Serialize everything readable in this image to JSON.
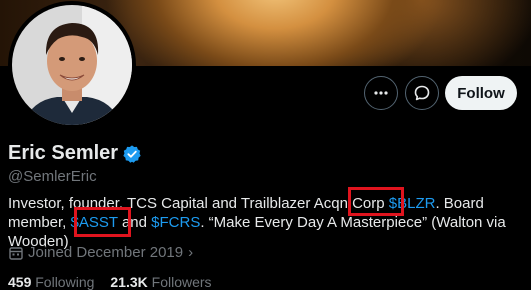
{
  "profile": {
    "display_name": "Eric Semler",
    "handle": "@SemlerEric",
    "verified": true,
    "bio": {
      "part1": "Investor, founder. TCS Capital and Trailblazer Acqn Corp ",
      "cashtag1": "$BLZR",
      "part2": ". Board member, ",
      "cashtag2": "$ASST",
      "part3": " and ",
      "cashtag3": "$FCRS",
      "part4": ". “Make Every Day A Masterpiece” (Walton via Wooden)"
    },
    "joined": "Joined December 2019",
    "following_count": "459",
    "following_label": "Following",
    "followers_count": "21.3K",
    "followers_label": "Followers"
  },
  "actions": {
    "more_icon": "more-horizontal-icon",
    "message_icon": "message-icon",
    "follow_label": "Follow"
  },
  "colors": {
    "background": "#000000",
    "accent": "#1d9bf0",
    "highlight_box": "#e0141e"
  }
}
